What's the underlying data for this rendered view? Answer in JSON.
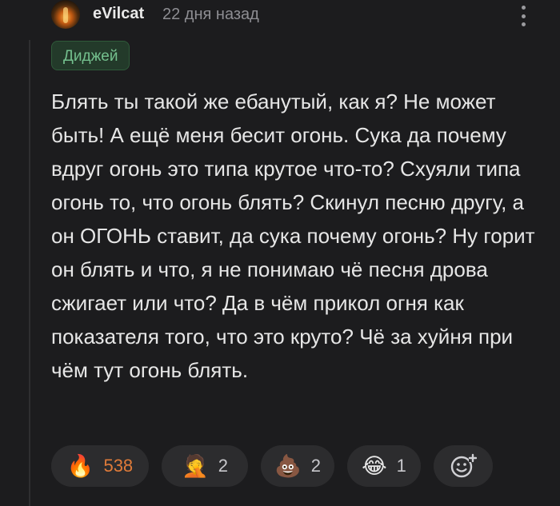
{
  "comment": {
    "author": "eVilcat",
    "timestamp": "22 дня назад",
    "tag": "Диджей",
    "text": "Блять ты такой же ебанутый, как я? Не может быть! А ещё меня бесит огонь. Сука да почему вдруг огонь это типа крутое что-то? Схуяли типа огонь то, что огонь блять? Скинул песню другу, а он ОГОНЬ ставит, да сука почему огонь? Ну горит он блять и что, я не понимаю чё песня дрова сжигает или что? Да в чём прикол огня как показателя того, что это круто? Чё за хуйня при чём тут огонь блять."
  },
  "reactions": [
    {
      "icon": "fire-emoji",
      "emoji": "🔥",
      "count": "538",
      "active": true
    },
    {
      "icon": "face-palm-emoji",
      "emoji": "🤦",
      "count": "2"
    },
    {
      "icon": "pile-of-poo-emoji",
      "emoji": "💩",
      "count": "2"
    },
    {
      "icon": "tears-of-joy-emoji",
      "emoji": "😂",
      "count": "1"
    }
  ],
  "add_reaction_icon": "add-reaction-icon",
  "colors": {
    "background": "#1c1c1e",
    "tag_bg": "#233a2a",
    "tag_text": "#74c08e",
    "active_count": "#e07b39",
    "muted": "#8e8e93"
  }
}
